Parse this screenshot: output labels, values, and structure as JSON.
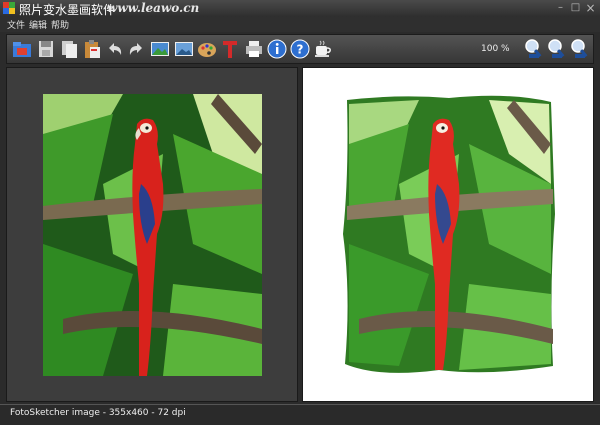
{
  "window": {
    "title": "照片变水墨画软件",
    "watermark_url": "www.leawo.cn",
    "minimize": "–",
    "maximize": "□",
    "close": "×"
  },
  "menu": {
    "items": [
      "文件",
      "编辑",
      "帮助"
    ]
  },
  "toolbar": {
    "zoom_level": "100 %",
    "icons": [
      "open-folder-icon",
      "save-icon",
      "copy-icon",
      "paste-icon",
      "undo-icon",
      "redo-icon",
      "original-image-icon",
      "sketch-image-icon",
      "palette-icon",
      "text-icon",
      "print-icon",
      "info-icon",
      "help-icon",
      "coffee-icon",
      "zoom-in-icon",
      "zoom-fit-icon",
      "zoom-out-icon"
    ]
  },
  "status": {
    "text": "FotoSketcher image - 355x460 - 72 dpi"
  },
  "colors": {
    "background": "#2b2b2b",
    "panel_left": "#3d3d3d",
    "panel_right": "#ffffff",
    "toolbar": "#454545"
  }
}
